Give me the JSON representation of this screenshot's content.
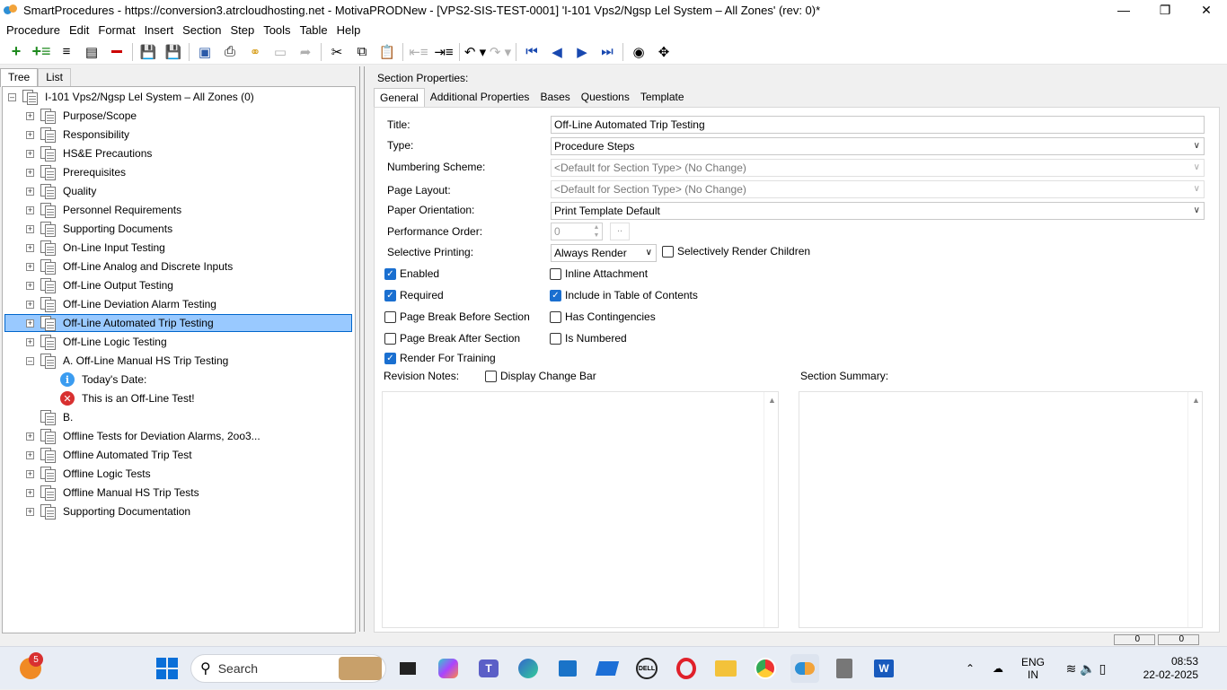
{
  "window": {
    "title": "SmartProcedures - https://conversion3.atrcloudhosting.net - MotivaPRODNew - [VPS2-SIS-TEST-0001] 'I-101 Vps2/Ngsp Lel System – All Zones' (rev: 0)*"
  },
  "menu": [
    "Procedure",
    "Edit",
    "Format",
    "Insert",
    "Section",
    "Step",
    "Tools",
    "Table",
    "Help"
  ],
  "left_tabs": [
    "Tree",
    "List"
  ],
  "tree": {
    "root": "I-101 Vps2/Ngsp Lel System – All Zones (0)",
    "items": [
      "Purpose/Scope",
      "Responsibility",
      "HS&E Precautions",
      "Prerequisites",
      "Quality",
      "Personnel Requirements",
      "Supporting Documents",
      "On-Line Input Testing",
      "Off-Line Analog and Discrete Inputs",
      "Off-Line Output Testing",
      "Off-Line Deviation Alarm Testing",
      "Off-Line Automated Trip Testing",
      "Off-Line Logic Testing",
      "A. Off-Line Manual HS Trip Testing",
      "Today's Date:",
      "This is an Off-Line Test!",
      "B.",
      "Offline Tests for Deviation Alarms, 2oo3...",
      "Offline Automated Trip Test",
      "Offline Logic Tests",
      "Offline Manual HS Trip Tests",
      "Supporting Documentation"
    ],
    "selected": "Off-Line Automated Trip Testing"
  },
  "section": {
    "header": "Section Properties:",
    "tabs": [
      "General",
      "Additional Properties",
      "Bases",
      "Questions",
      "Template"
    ],
    "labels": {
      "title": "Title:",
      "type": "Type:",
      "numbering": "Numbering Scheme:",
      "page_layout": "Page Layout:",
      "orientation": "Paper Orientation:",
      "perf_order": "Performance Order:",
      "selective": "Selective Printing:",
      "revision_notes": "Revision Notes:",
      "summary": "Section Summary:"
    },
    "values": {
      "title": "Off-Line Automated Trip Testing",
      "type": "Procedure Steps",
      "numbering": "<Default for Section Type> (No Change)",
      "page_layout": "<Default for Section Type> (No Change)",
      "orientation": "Print Template Default",
      "perf_order": "0",
      "perf_btn": "..",
      "selective": "Always Render"
    },
    "checkboxes": {
      "selectively_render_children": {
        "label": "Selectively Render Children",
        "checked": false
      },
      "enabled": {
        "label": "Enabled",
        "checked": true
      },
      "inline_attachment": {
        "label": "Inline Attachment",
        "checked": false
      },
      "required": {
        "label": "Required",
        "checked": true
      },
      "include_toc": {
        "label": "Include in Table of Contents",
        "checked": true
      },
      "page_break_before": {
        "label": "Page Break Before Section",
        "checked": false
      },
      "has_contingencies": {
        "label": "Has Contingencies",
        "checked": false
      },
      "page_break_after": {
        "label": "Page Break After Section",
        "checked": false
      },
      "is_numbered": {
        "label": "Is Numbered",
        "checked": false
      },
      "render_training": {
        "label": "Render For Training",
        "checked": true
      },
      "display_change_bar": {
        "label": "Display Change Bar",
        "checked": false
      }
    }
  },
  "statusbar": {
    "box1": "0",
    "box2": "0"
  },
  "taskbar": {
    "search": "Search",
    "notif_badge": "5",
    "lang": "ENG",
    "region": "IN",
    "time": "08:53",
    "date": "22-02-2025"
  }
}
